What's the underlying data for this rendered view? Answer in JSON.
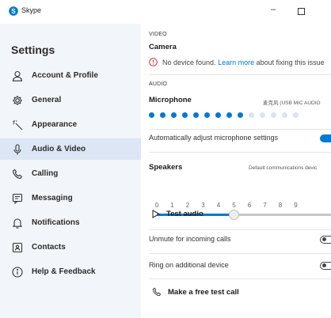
{
  "window": {
    "title": "Skype",
    "minimize_glyph": "–"
  },
  "sidebar": {
    "title": "Settings",
    "active_index": 3,
    "items": [
      {
        "label": "Account & Profile",
        "icon": "person-icon"
      },
      {
        "label": "General",
        "icon": "gear-icon"
      },
      {
        "label": "Appearance",
        "icon": "magic-wand-icon"
      },
      {
        "label": "Audio & Video",
        "icon": "microphone-icon"
      },
      {
        "label": "Calling",
        "icon": "phone-icon"
      },
      {
        "label": "Messaging",
        "icon": "message-icon"
      },
      {
        "label": "Notifications",
        "icon": "bell-icon"
      },
      {
        "label": "Contacts",
        "icon": "contact-card-icon"
      },
      {
        "label": "Help & Feedback",
        "icon": "info-icon"
      }
    ]
  },
  "video": {
    "header": "VIDEO",
    "camera_label": "Camera",
    "warning_text": "No device found.",
    "learn_more": "Learn more",
    "warning_suffix": "about fixing this issue"
  },
  "audio": {
    "header": "AUDIO",
    "microphone_label": "Microphone",
    "microphone_device": "麦克风 (USB MIC AUDIO",
    "mic_level_active_dots": 9,
    "mic_level_total_dots": 14,
    "auto_adjust_label": "Automatically adjust microphone settings",
    "auto_adjust_on": true,
    "speakers_label": "Speakers",
    "speakers_device": "Default communications devic",
    "volume_ticks": [
      "0",
      "1",
      "2",
      "3",
      "4",
      "5",
      "6",
      "7",
      "8",
      "9"
    ],
    "volume_value": 5,
    "test_audio_label": "Test audio",
    "unmute_label": "Unmute for incoming calls",
    "unmute_on": false,
    "ring_label": "Ring on additional device",
    "ring_on": false,
    "test_call_label": "Make a free test call"
  },
  "colors": {
    "accent": "#0078d4",
    "warning": "#d13438",
    "dot_inactive": "#dce3ee",
    "dot_active": "#0078d4"
  }
}
